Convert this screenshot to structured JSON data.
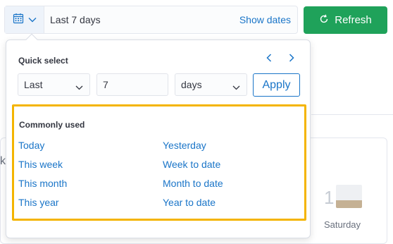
{
  "header": {
    "date_range_text": "Last 7 days",
    "show_dates_label": "Show dates",
    "refresh_label": "Refresh"
  },
  "quick_select": {
    "title": "Quick select",
    "direction": "Last",
    "value": "7",
    "unit": "days",
    "apply_label": "Apply"
  },
  "commonly_used": {
    "title": "Commonly used",
    "items": [
      "Today",
      "Yesterday",
      "This week",
      "Week to date",
      "This month",
      "Month to date",
      "This year",
      "Year to date"
    ]
  },
  "background": {
    "left_fragment": "k",
    "day_number": "1",
    "day_label": "Saturday"
  },
  "colors": {
    "link_blue": "#1a75c8",
    "refresh_green": "#1fa25a",
    "highlight_border": "#f4b400"
  },
  "icons": {
    "calendar": "calendar-icon",
    "chevron_down": "chevron-down-icon",
    "refresh": "refresh-icon",
    "prev": "chevron-left-icon",
    "next": "chevron-right-icon"
  }
}
